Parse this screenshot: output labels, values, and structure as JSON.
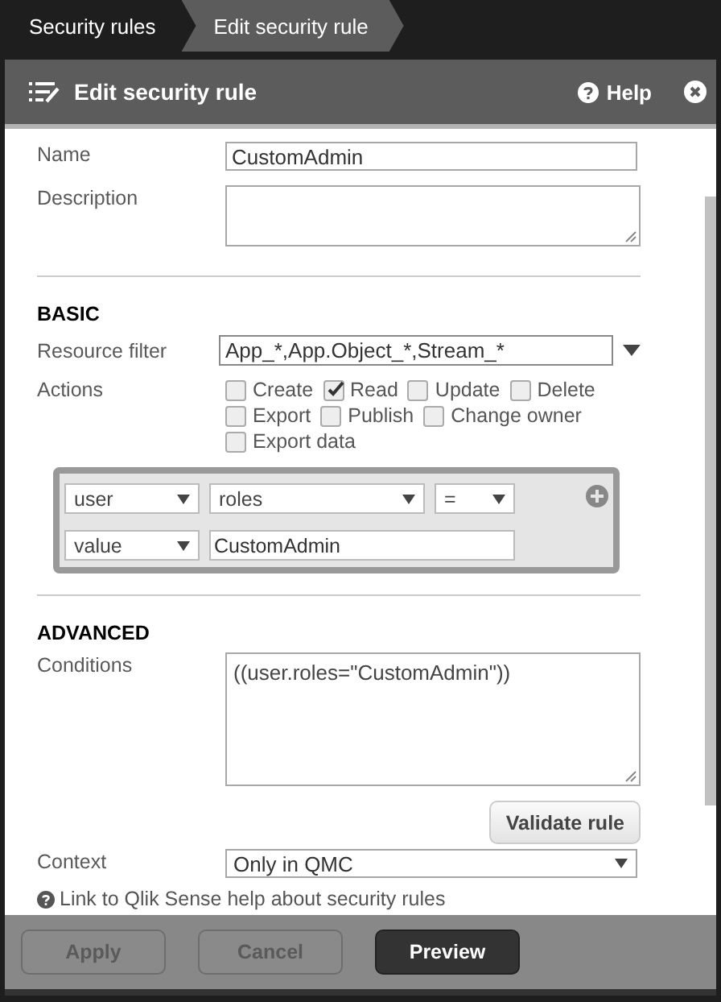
{
  "breadcrumbs": [
    {
      "label": "Security rules",
      "selected": false
    },
    {
      "label": "Edit security rule",
      "selected": true
    }
  ],
  "dialog": {
    "title": "Edit security rule",
    "help_label": "Help"
  },
  "form": {
    "name": {
      "label": "Name",
      "value": "CustomAdmin"
    },
    "description": {
      "label": "Description"
    },
    "basic": {
      "heading": "BASIC",
      "resource_filter": {
        "label": "Resource filter",
        "value": "App_*,App.Object_*,Stream_*"
      },
      "actions": {
        "label": "Actions",
        "options": [
          {
            "label": "Create",
            "checked": false
          },
          {
            "label": "Read",
            "checked": true
          },
          {
            "label": "Update",
            "checked": false
          },
          {
            "label": "Delete",
            "checked": false
          },
          {
            "label": "Export",
            "checked": false
          },
          {
            "label": "Publish",
            "checked": false
          },
          {
            "label": "Change owner",
            "checked": false
          },
          {
            "label": "Export data",
            "checked": false
          }
        ]
      },
      "condition_builder": {
        "rows": [
          [
            {
              "kind": "select",
              "value": "user"
            },
            {
              "kind": "select",
              "value": "roles"
            },
            {
              "kind": "select",
              "value": "="
            }
          ],
          [
            {
              "kind": "select",
              "value": "value"
            },
            {
              "kind": "text",
              "value": "CustomAdmin"
            }
          ]
        ]
      }
    },
    "advanced": {
      "heading": "ADVANCED",
      "conditions": {
        "label": "Conditions",
        "value": "((user.roles=\"CustomAdmin\"))"
      },
      "validate_button": "Validate rule",
      "context": {
        "label": "Context",
        "value": "Only in QMC"
      }
    },
    "help_link": "Link to Qlik Sense help about security rules"
  },
  "footer": {
    "buttons": [
      {
        "label": "Apply",
        "disabled": true
      },
      {
        "label": "Cancel",
        "disabled": true
      },
      {
        "label": "Preview",
        "disabled": false
      }
    ]
  }
}
